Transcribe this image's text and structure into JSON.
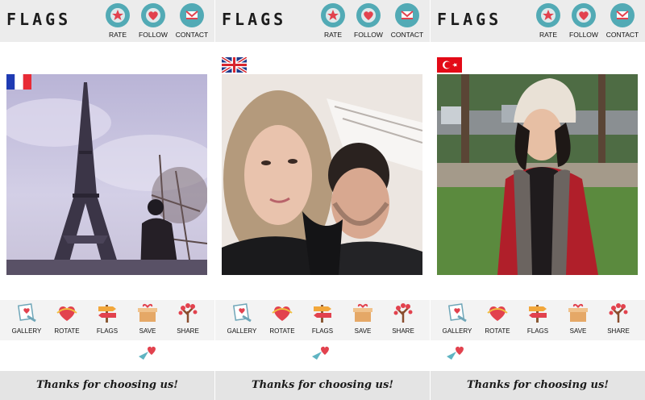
{
  "app": {
    "brand": "FLAGS"
  },
  "header": {
    "rate_label": "RATE",
    "follow_label": "FOLLOW",
    "contact_label": "CONTACT",
    "accent_color": "#52aab5"
  },
  "panels": [
    {
      "flag": "france-flag",
      "photo": "eiffel-tower-photo"
    },
    {
      "flag": "uk-flag",
      "photo": "couple-selfie-photo"
    },
    {
      "flag": "turkey-flag",
      "photo": "woman-in-park-photo"
    }
  ],
  "toolbar": {
    "gallery_label": "GALLERY",
    "rotate_label": "ROTATE",
    "flags_label": "FLAGS",
    "save_label": "SAVE",
    "share_label": "SHARE"
  },
  "footer": {
    "text": "Thanks for choosing us!"
  }
}
